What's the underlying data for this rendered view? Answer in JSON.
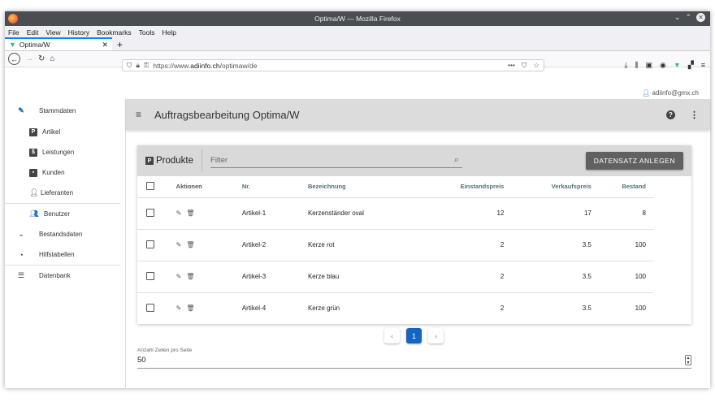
{
  "window": {
    "title": "Optima/W — Mozilla Firefox"
  },
  "menu": [
    "File",
    "Edit",
    "View",
    "History",
    "Bookmarks",
    "Tools",
    "Help"
  ],
  "tab": {
    "title": "Optima/W"
  },
  "url": {
    "prefix": "https://www.",
    "domain": "adiinfo.ch",
    "path": "/optimaw/de"
  },
  "user": {
    "email": "adiinfo@gmx.ch"
  },
  "sidebar": {
    "stammdaten": "Stammdaten",
    "artikel": "Artikel",
    "leistungen": "Leistungen",
    "kunden": "Kunden",
    "lieferanten": "Lieferanten",
    "benutzer": "Benutzer",
    "bestandsdaten": "Bestandsdaten",
    "hilfstabellen": "Hilfstabellen",
    "datenbank": "Datenbank"
  },
  "header": {
    "title": "Auftragsbearbeitung Optima/W"
  },
  "products": {
    "title": "Produkte",
    "filter_placeholder": "Filter",
    "add_button": "DATENSATZ ANLEGEN",
    "columns": {
      "aktionen": "Aktionen",
      "nr": "Nr.",
      "bezeichnung": "Bezeichnung",
      "einstandspreis": "Einstandspreis",
      "verkaufspreis": "Verkaufspreis",
      "bestand": "Bestand"
    },
    "rows": [
      {
        "nr": "Artikel-1",
        "bezeichnung": "Kerzenständer oval",
        "einstandspreis": "12",
        "verkaufspreis": "17",
        "bestand": "8"
      },
      {
        "nr": "Artikel-2",
        "bezeichnung": "Kerze rot",
        "einstandspreis": "2",
        "verkaufspreis": "3.5",
        "bestand": "100"
      },
      {
        "nr": "Artikel-3",
        "bezeichnung": "Kerze blau",
        "einstandspreis": "2",
        "verkaufspreis": "3.5",
        "bestand": "100"
      },
      {
        "nr": "Artikel-4",
        "bezeichnung": "Kerze grün",
        "einstandspreis": "2",
        "verkaufspreis": "3.5",
        "bestand": "100"
      }
    ]
  },
  "pagination": {
    "prev": "‹",
    "current": "1",
    "next": "›"
  },
  "rows_per_page": {
    "label": "Anzahl Zeilen pro Seite",
    "value": "50"
  }
}
